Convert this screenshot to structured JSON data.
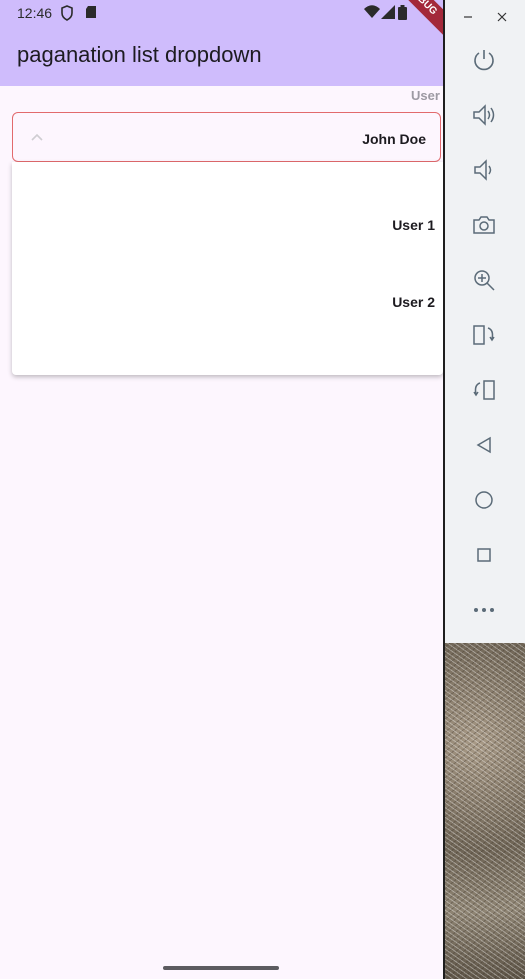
{
  "status_bar": {
    "time": "12:46",
    "icons": [
      "shield-icon",
      "sd-card-icon",
      "wifi-icon",
      "cell-signal-icon",
      "battery-icon"
    ]
  },
  "app_bar": {
    "title": "paganation list dropdown",
    "debug_banner": "DEBUG"
  },
  "dropdown": {
    "label": "User",
    "selected": "John Doe",
    "border_color": "#e26a6d",
    "options": [
      "User 1",
      "User 2"
    ]
  },
  "emulator_toolbar": {
    "window_controls": [
      "minimize-icon",
      "close-icon"
    ],
    "buttons": [
      "power-icon",
      "volume-up-icon",
      "volume-down-icon",
      "camera-icon",
      "zoom-in-icon",
      "rotate-left-icon",
      "rotate-right-icon",
      "back-icon",
      "home-icon",
      "overview-icon",
      "more-icon"
    ]
  },
  "colors": {
    "app_bar": "#cfbcfc",
    "background": "#fdf6fe",
    "debug_banner": "#a3283a"
  }
}
